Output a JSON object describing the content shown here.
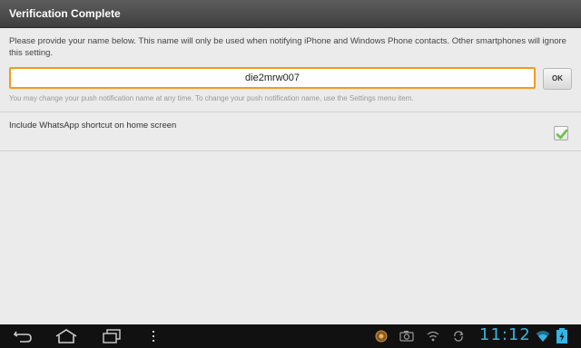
{
  "dialog": {
    "title": "Verification Complete",
    "description": "Please provide your name below. This name will only be used when notifying iPhone and Windows Phone contacts. Other smartphones will ignore this setting.",
    "name_value": "die2mrw007",
    "ok_label": "OK",
    "hint": "You may change your push notification name at any time. To change your push notification name, use the Settings menu item.",
    "shortcut_label": "Include WhatsApp shortcut on home screen",
    "shortcut_checked": true
  },
  "system_bar": {
    "clock": "11:12",
    "nav_icons": [
      "back-icon",
      "home-icon",
      "recent-apps-icon",
      "menu-icon"
    ],
    "status_icons": [
      "app-notification-icon",
      "camera-icon",
      "wifi-notification-icon",
      "sync-icon",
      "wifi-signal-icon",
      "battery-icon"
    ]
  },
  "colors": {
    "accent_orange": "#f29b1d",
    "check_green": "#6cc04a",
    "clock_blue": "#33b5e5",
    "title_bar": "#4a4a4a",
    "background": "#ebebeb"
  }
}
